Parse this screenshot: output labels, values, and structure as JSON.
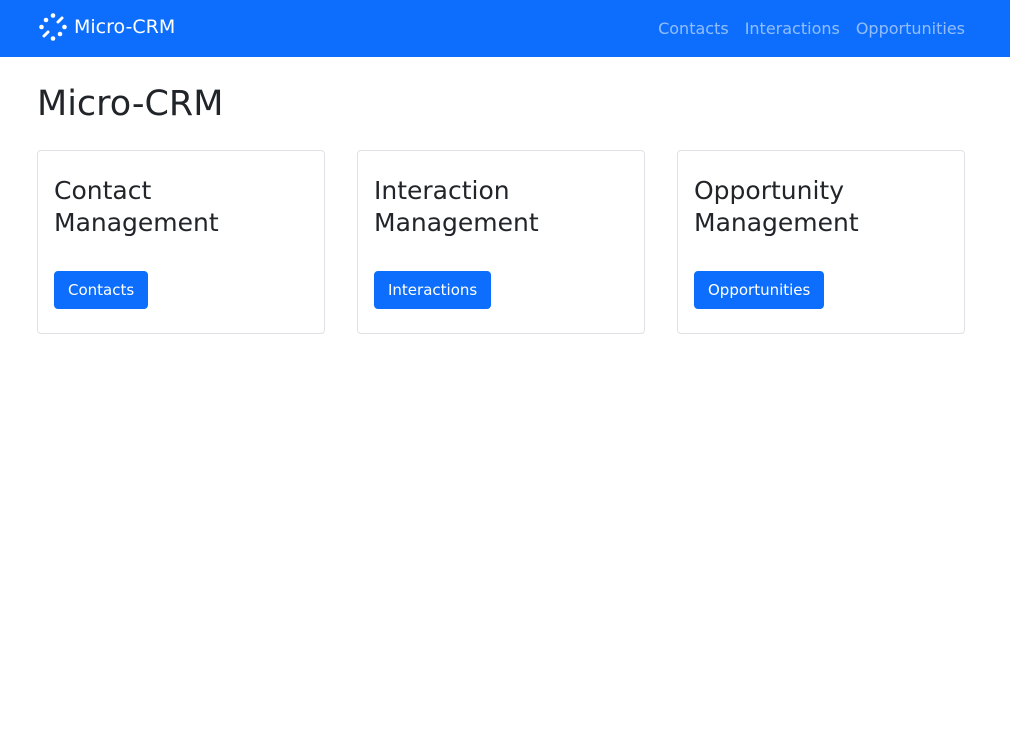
{
  "navbar": {
    "brand_icon": "logo-icon",
    "brand_name": "Micro-CRM",
    "links": [
      {
        "label": "Contacts"
      },
      {
        "label": "Interactions"
      },
      {
        "label": "Opportunities"
      }
    ],
    "background_color": "#0d6efd"
  },
  "page": {
    "title": "Micro-CRM"
  },
  "cards": [
    {
      "title": "Contact Management",
      "button_label": "Contacts"
    },
    {
      "title": "Interaction Management",
      "button_label": "Interactions"
    },
    {
      "title": "Opportunity Management",
      "button_label": "Opportunities"
    }
  ],
  "colors": {
    "primary": "#0d6efd",
    "text": "#212529",
    "border": "#dee2e6"
  }
}
